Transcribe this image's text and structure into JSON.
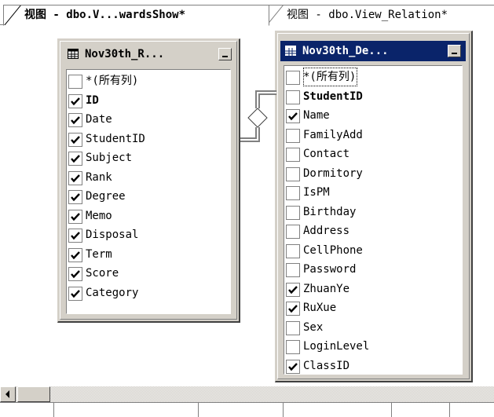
{
  "tabs": [
    {
      "label": "视图 - dbo.V...wardsShow*",
      "active": true
    },
    {
      "label": "视图 - dbo.View_Relation*",
      "active": false
    }
  ],
  "left_table": {
    "title": "Nov30th_R...",
    "columns": [
      {
        "name": "*(所有列)",
        "checked": false,
        "bold": false
      },
      {
        "name": "ID",
        "checked": true,
        "bold": true
      },
      {
        "name": "Date",
        "checked": true,
        "bold": false
      },
      {
        "name": "StudentID",
        "checked": true,
        "bold": false
      },
      {
        "name": "Subject",
        "checked": true,
        "bold": false
      },
      {
        "name": "Rank",
        "checked": true,
        "bold": false
      },
      {
        "name": "Degree",
        "checked": true,
        "bold": false
      },
      {
        "name": "Memo",
        "checked": true,
        "bold": false
      },
      {
        "name": "Disposal",
        "checked": true,
        "bold": false
      },
      {
        "name": "Term",
        "checked": true,
        "bold": false
      },
      {
        "name": "Score",
        "checked": true,
        "bold": false
      },
      {
        "name": "Category",
        "checked": true,
        "bold": false
      }
    ]
  },
  "right_table": {
    "title": "Nov30th_De...",
    "columns": [
      {
        "name": "*(所有列)",
        "checked": false,
        "bold": false,
        "focus": true
      },
      {
        "name": "StudentID",
        "checked": false,
        "bold": true
      },
      {
        "name": "Name",
        "checked": true,
        "bold": false
      },
      {
        "name": "FamilyAdd",
        "checked": false,
        "bold": false
      },
      {
        "name": "Contact",
        "checked": false,
        "bold": false
      },
      {
        "name": "Dormitory",
        "checked": false,
        "bold": false
      },
      {
        "name": "IsPM",
        "checked": false,
        "bold": false
      },
      {
        "name": "Birthday",
        "checked": false,
        "bold": false
      },
      {
        "name": "Address",
        "checked": false,
        "bold": false
      },
      {
        "name": "CellPhone",
        "checked": false,
        "bold": false
      },
      {
        "name": "Password",
        "checked": false,
        "bold": false
      },
      {
        "name": "ZhuanYe",
        "checked": true,
        "bold": false
      },
      {
        "name": "RuXue",
        "checked": true,
        "bold": false
      },
      {
        "name": "Sex",
        "checked": false,
        "bold": false
      },
      {
        "name": "LoginLevel",
        "checked": false,
        "bold": false
      },
      {
        "name": "ClassID",
        "checked": true,
        "bold": false
      }
    ]
  },
  "colors": {
    "active_title_bg": "#0a246a",
    "inactive_title_bg": "#d4d0c8",
    "face": "#d4d0c8"
  },
  "icons": {
    "table_icon": "table-grid-icon",
    "minimize": "minimize-icon",
    "relationship": "join-diamond-icon",
    "scroll_left": "arrow-left-icon"
  }
}
